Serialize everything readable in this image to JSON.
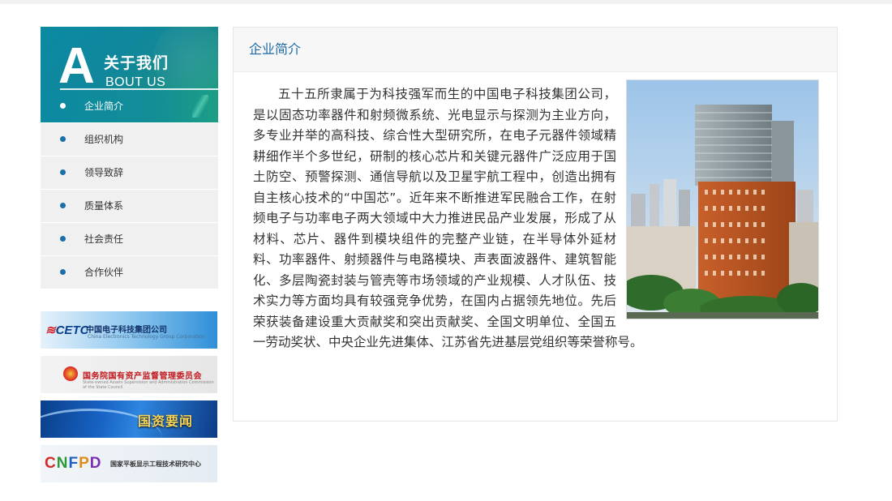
{
  "sidebar": {
    "about_big_letter": "A",
    "about_title_cn": "关于我们",
    "about_title_en": "BOUT US",
    "menu": [
      {
        "label": "企业简介",
        "active": true
      },
      {
        "label": "组织机构",
        "active": false
      },
      {
        "label": "领导致辞",
        "active": false
      },
      {
        "label": "质量体系",
        "active": false
      },
      {
        "label": "社会责任",
        "active": false
      },
      {
        "label": "合作伙伴",
        "active": false
      }
    ],
    "links": {
      "cetc": {
        "logo": "CETC",
        "name": "中国电子科技集团公司",
        "sub": "China Electronics Technology Group Corporation"
      },
      "sasac": {
        "name": "国务院国有资产监督管理委员会",
        "sub": "State-owned Assets Supervision and Administration Commission of the State Council"
      },
      "news": {
        "text": "国资要闻"
      },
      "cnfpd": {
        "logo": "CNFPD",
        "name": "国家平板显示工程技术研究中心"
      }
    }
  },
  "main": {
    "section_title": "企业简介",
    "body_text": "五十五所隶属于为科技强军而生的中国电子科技集团公司，是以固态功率器件和射频微系统、光电显示与探测为主业方向，多专业并举的高科技、综合性大型研究所，在电子元器件领域精耕细作半个多世纪，研制的核心芯片和关键元器件广泛应用于国土防空、预警探测、通信导航以及卫星宇航工程中，创造出拥有自主核心技术的“中国芯”。近年来不断推进军民融合工作，在射频电子与功率电子两大领域中大力推进民品产业发展，形成了从材料、芯片、器件到模块组件的完整产业链，在半导体外延材料、功率器件、射频器件与电路模块、声表面波器件、建筑智能化、多层陶瓷封装与管壳等市场领域的产业规模、人才队伍、技术实力等方面均具有较强竞争优势，在国内占据领先地位。先后荣获装备建设重大贡献奖和突出贡献奖、全国文明单位、全国五一劳动奖状、中央企业先进集体、江苏省先进基层党组织等荣誉称号。"
  },
  "colors": {
    "accent_teal": "#0c8aa2",
    "title_blue": "#1e6aa5",
    "menu_dot": "#1a6fa8",
    "menu_bg": "#f0f0f0",
    "text": "#333333"
  }
}
